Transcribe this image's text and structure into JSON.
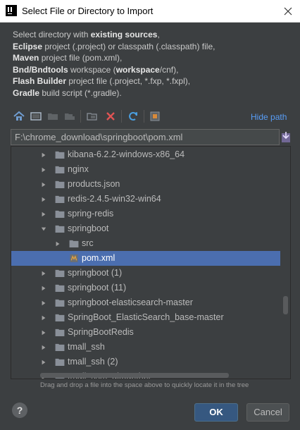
{
  "window": {
    "title": "Select File or Directory to Import"
  },
  "description": {
    "lines": [
      [
        {
          "t": "Select directory with ",
          "b": false
        },
        {
          "t": "existing sources",
          "b": true
        },
        {
          "t": ",",
          "b": false
        }
      ],
      [
        {
          "t": "Eclipse",
          "b": true
        },
        {
          "t": " project (.project) or classpath (.classpath) file,",
          "b": false
        }
      ],
      [
        {
          "t": "Maven",
          "b": true
        },
        {
          "t": " project file (pom.xml),",
          "b": false
        }
      ],
      [
        {
          "t": "Bnd/Bndtools",
          "b": true
        },
        {
          "t": " workspace (",
          "b": false
        },
        {
          "t": "workspace",
          "b": true
        },
        {
          "t": "/cnf),",
          "b": false
        }
      ],
      [
        {
          "t": "Flash Builder",
          "b": true
        },
        {
          "t": " project file (.project, *.fxp, *.fxpl),",
          "b": false
        }
      ],
      [
        {
          "t": "Gradle",
          "b": true
        },
        {
          "t": " build script (*.gradle).",
          "b": false
        }
      ]
    ]
  },
  "toolbar": {
    "buttons": [
      "home-icon",
      "desktop-icon",
      "project-folder-icon",
      "module-folder-icon",
      "new-folder-icon",
      "delete-icon",
      "refresh-icon",
      "show-hidden-icon"
    ],
    "hide_path_label": "Hide path"
  },
  "path": {
    "value": "F:\\chrome_download\\springboot\\pom.xml"
  },
  "tree": {
    "rows": [
      {
        "label": "kibana-6.2.2-windows-x86_64",
        "indent": 1,
        "expanded": false,
        "type": "folder",
        "selected": false
      },
      {
        "label": "nginx",
        "indent": 1,
        "expanded": false,
        "type": "folder",
        "selected": false
      },
      {
        "label": "products.json",
        "indent": 1,
        "expanded": false,
        "type": "folder",
        "selected": false
      },
      {
        "label": "redis-2.4.5-win32-win64",
        "indent": 1,
        "expanded": false,
        "type": "folder",
        "selected": false
      },
      {
        "label": "spring-redis",
        "indent": 1,
        "expanded": false,
        "type": "folder",
        "selected": false
      },
      {
        "label": "springboot",
        "indent": 1,
        "expanded": true,
        "type": "folder",
        "selected": false
      },
      {
        "label": "src",
        "indent": 2,
        "expanded": false,
        "type": "folder",
        "selected": false
      },
      {
        "label": "pom.xml",
        "indent": 2,
        "expanded": null,
        "type": "maven-file",
        "selected": true
      },
      {
        "label": "springboot (1)",
        "indent": 1,
        "expanded": false,
        "type": "folder",
        "selected": false
      },
      {
        "label": "springboot (11)",
        "indent": 1,
        "expanded": false,
        "type": "folder",
        "selected": false
      },
      {
        "label": "springboot-elasticsearch-master",
        "indent": 1,
        "expanded": false,
        "type": "folder",
        "selected": false
      },
      {
        "label": "SpringBoot_ElasticSearch_base-master",
        "indent": 1,
        "expanded": false,
        "type": "folder",
        "selected": false
      },
      {
        "label": "SpringBootRedis",
        "indent": 1,
        "expanded": false,
        "type": "folder",
        "selected": false
      },
      {
        "label": "tmall_ssh",
        "indent": 1,
        "expanded": false,
        "type": "folder",
        "selected": false
      },
      {
        "label": "tmall_ssh (2)",
        "indent": 1,
        "expanded": false,
        "type": "folder",
        "selected": false
      },
      {
        "label": "tmall_ssm_altogether",
        "indent": 1,
        "expanded": false,
        "type": "folder",
        "selected": false
      }
    ]
  },
  "hint": "Drag and drop a file into the space above to quickly locate it in the tree",
  "buttons": {
    "help": "?",
    "ok": "OK",
    "cancel": "Cancel"
  },
  "colors": {
    "background": "#3c3f41",
    "selection": "#4b6eaf",
    "link": "#589df6",
    "ok_button": "#365880",
    "folder": "#8a9099"
  }
}
